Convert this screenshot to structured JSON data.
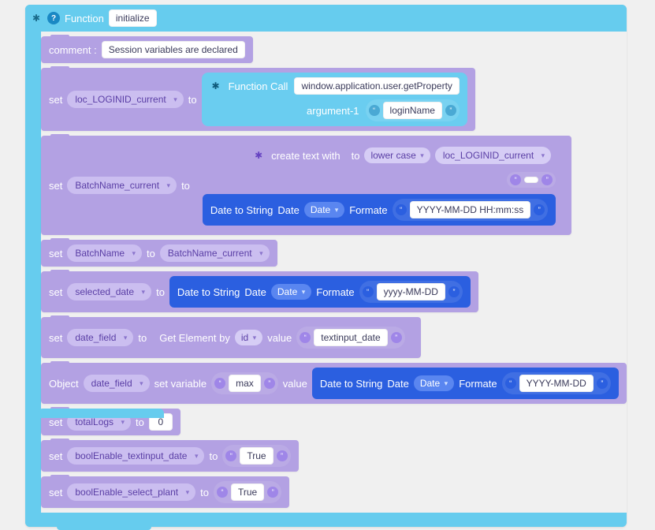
{
  "function": {
    "header_label": "Function",
    "name": "initialize"
  },
  "stmts": {
    "comment": {
      "label": "comment :",
      "text": "Session variables are declared"
    },
    "setLoginId": {
      "set": "set",
      "var": "loc_LOGINID_current",
      "to": "to",
      "funccall": {
        "label": "Function Call",
        "fn": "window.application.user.getProperty",
        "arg_label": "argument-1",
        "arg_value": "loginName"
      }
    },
    "setBatchNameCurrent": {
      "set": "set",
      "var": "BatchName_current",
      "to": "to",
      "create_text_with": {
        "label": "create text with",
        "to_label": "to",
        "case": "lower case",
        "src": "loc_LOGINID_current",
        "empty_string": "",
        "date": {
          "label": "Date to String",
          "date_label": "Date",
          "date_pill": "Date",
          "format_label": "Formate",
          "format_value": "YYYY-MM-DD HH:mm:ss"
        }
      }
    },
    "setBatchName": {
      "set": "set",
      "var": "BatchName",
      "to": "to",
      "value_var": "BatchName_current"
    },
    "setSelectedDate": {
      "set": "set",
      "var": "selected_date",
      "to": "to",
      "date": {
        "label": "Date to String",
        "date_label": "Date",
        "date_pill": "Date",
        "format_label": "Formate",
        "format_value": "yyyy-MM-DD"
      }
    },
    "setDateField": {
      "set": "set",
      "var": "date_field",
      "to": "to",
      "getel": {
        "label": "Get Element by",
        "by": "id",
        "value_label": "value",
        "value": "textinput_date"
      }
    },
    "objDateFieldMax": {
      "object_label": "Object",
      "obj": "date_field",
      "setvar_label": "set variable",
      "attr": "max",
      "value_label": "value",
      "date": {
        "label": "Date to String",
        "date_label": "Date",
        "date_pill": "Date",
        "format_label": "Formate",
        "format_value": "YYYY-MM-DD"
      }
    },
    "setTotalLogs": {
      "set": "set",
      "var": "totalLogs",
      "to": "to",
      "value": "0"
    },
    "setBoolDate": {
      "set": "set",
      "var": "boolEnable_textinput_date",
      "to": "to",
      "value": "True"
    },
    "setBoolPlant": {
      "set": "set",
      "var": "boolEnable_select_plant",
      "to": "to",
      "value": "True"
    }
  }
}
